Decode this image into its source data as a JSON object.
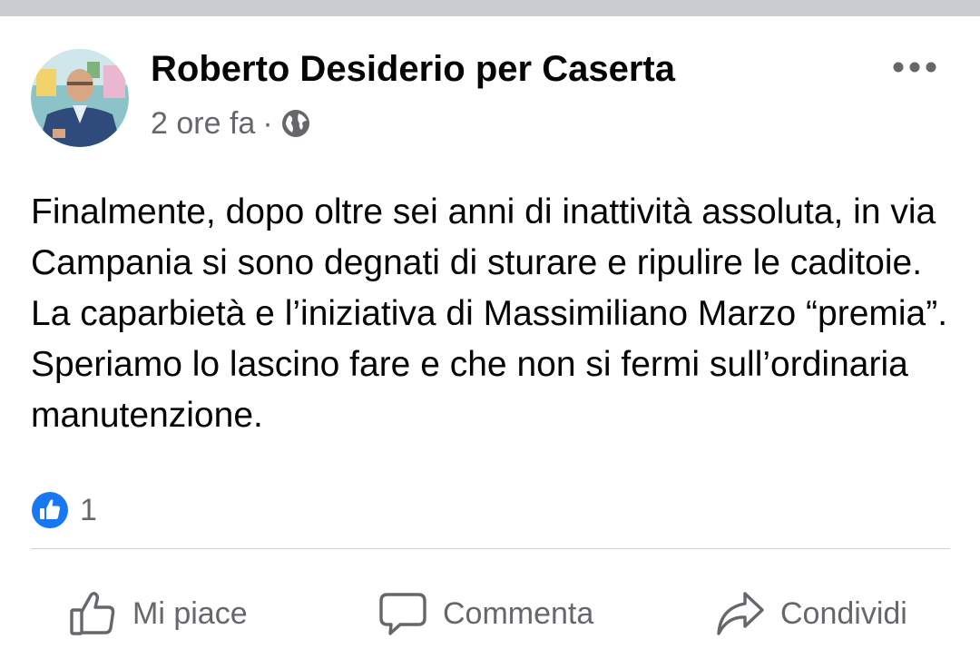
{
  "post": {
    "author": "Roberto Desiderio per Caserta",
    "time": "2 ore fa",
    "separator": "·",
    "privacy_icon": "globe-icon",
    "text": "Finalmente, dopo oltre sei anni di inattività assoluta, in via Campania si sono degnati di sturare e ripulire le caditoie. La caparbietà e l’iniziativa di Massimiliano Marzo “premia”. Speriamo lo lascino fare e che non si fermi sull’ordinaria manutenzione.",
    "reactions": {
      "icon": "like-reaction-icon",
      "count": "1"
    }
  },
  "actions": {
    "like": "Mi piace",
    "comment": "Commenta",
    "share": "Condividi"
  },
  "colors": {
    "primary_text": "#050505",
    "secondary_text": "#65676b",
    "like_blue": "#1877f2",
    "divider": "#ced0d4",
    "top_strip": "#c9ccd1"
  }
}
